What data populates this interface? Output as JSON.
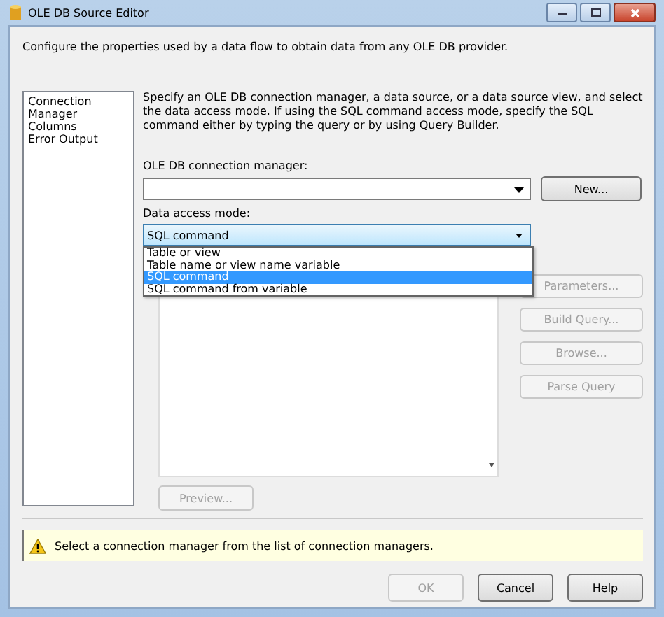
{
  "window": {
    "title": "OLE DB Source Editor"
  },
  "description": "Configure the properties used by a data flow to obtain data from any OLE DB provider.",
  "sidebar": {
    "items": [
      {
        "label": "Connection Manager"
      },
      {
        "label": "Columns"
      },
      {
        "label": "Error Output"
      }
    ]
  },
  "instructions": "Specify an OLE DB connection manager, a data source, or a data source view, and select the data access mode. If using the SQL command access mode, specify the SQL command either by typing the query or by using Query Builder.",
  "connection_manager": {
    "label": "OLE DB connection manager:",
    "button": {
      "label": "New...",
      "disabled": false
    }
  },
  "access_mode": {
    "label": "Data access mode:",
    "value": "SQL command",
    "expanded": true,
    "options": [
      {
        "label": "Table or view",
        "selected": false
      },
      {
        "label": "Table name or view name variable",
        "selected": false
      },
      {
        "label": "SQL command",
        "selected": true
      },
      {
        "label": "SQL command from variable",
        "selected": false
      }
    ]
  },
  "side_buttons": [
    {
      "label": "Parameters...",
      "disabled": true
    },
    {
      "label": "Build Query...",
      "disabled": true
    },
    {
      "label": "Browse...",
      "disabled": true
    },
    {
      "label": "Parse Query",
      "disabled": true
    }
  ],
  "preview_button": {
    "label": "Preview...",
    "disabled": true
  },
  "warning": "Select a connection manager from the list of connection managers.",
  "footer_buttons": [
    {
      "label": "OK",
      "disabled": true
    },
    {
      "label": "Cancel",
      "disabled": false
    },
    {
      "label": "Help",
      "disabled": false
    }
  ]
}
